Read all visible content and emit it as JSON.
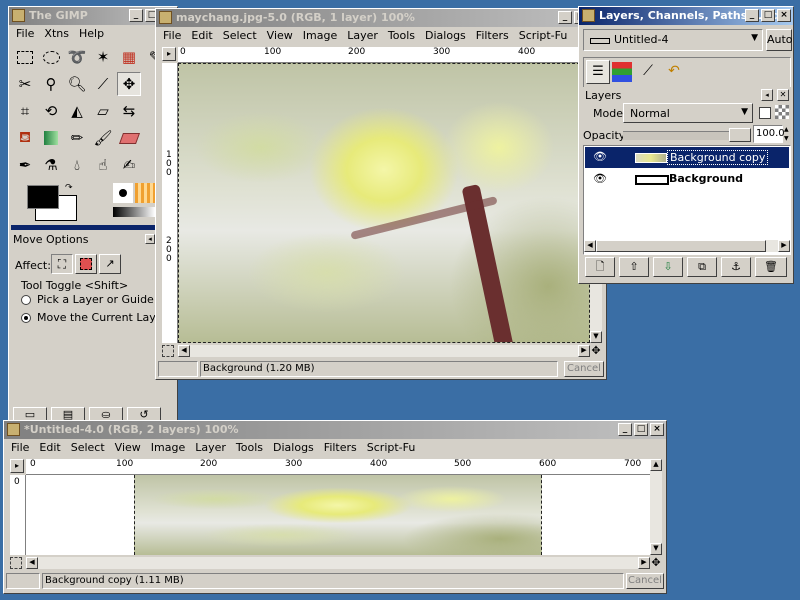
{
  "toolbox": {
    "title": "The GIMP",
    "menus": [
      "File",
      "Xtns",
      "Help"
    ],
    "tool_options_title": "Move Options",
    "affect_label": "Affect:",
    "tool_toggle_label": "Tool Toggle  <Shift>",
    "option_pick": "Pick a Layer or Guide to Move",
    "option_move": "Move the Current Layer"
  },
  "image_window": {
    "title": "maychang.jpg-5.0 (RGB, 1 layer) 100%",
    "menus": [
      "File",
      "Edit",
      "Select",
      "View",
      "Image",
      "Layer",
      "Tools",
      "Dialogs",
      "Filters",
      "Script-Fu"
    ],
    "ruler_h": [
      "0",
      "100",
      "200",
      "300",
      "400"
    ],
    "ruler_v": [
      "1\n0\n0",
      "2\n0\n0"
    ],
    "status": "Background (1.20 MB)",
    "cancel": "Cancel"
  },
  "layers_dialog": {
    "title": "Layers, Channels, Paths, Undo",
    "image_select": "Untitled-4",
    "auto_label": "Auto",
    "section_title": "Layers",
    "mode_label": "Mode:",
    "mode_value": "Normal",
    "opacity_label": "Opacity:",
    "opacity_value": "100.0",
    "opacity_fraction": 1.0,
    "layers": [
      {
        "name": "Background copy",
        "selected": true
      },
      {
        "name": "Background",
        "selected": false
      }
    ]
  },
  "untitled_window": {
    "title": "*Untitled-4.0 (RGB, 2 layers) 100%",
    "menus": [
      "File",
      "Edit",
      "Select",
      "View",
      "Image",
      "Layer",
      "Tools",
      "Dialogs",
      "Filters",
      "Script-Fu"
    ],
    "ruler_h": [
      "0",
      "100",
      "200",
      "300",
      "400",
      "500",
      "600",
      "700"
    ],
    "ruler_v": [
      "0"
    ],
    "status": "Background copy (1.11 MB)",
    "cancel": "Cancel"
  },
  "colors": {
    "desktop": "#3a6ea5",
    "titlebar_active": "#0a246a",
    "selection": "#0a246a",
    "chrome": "#d4d0c8"
  }
}
